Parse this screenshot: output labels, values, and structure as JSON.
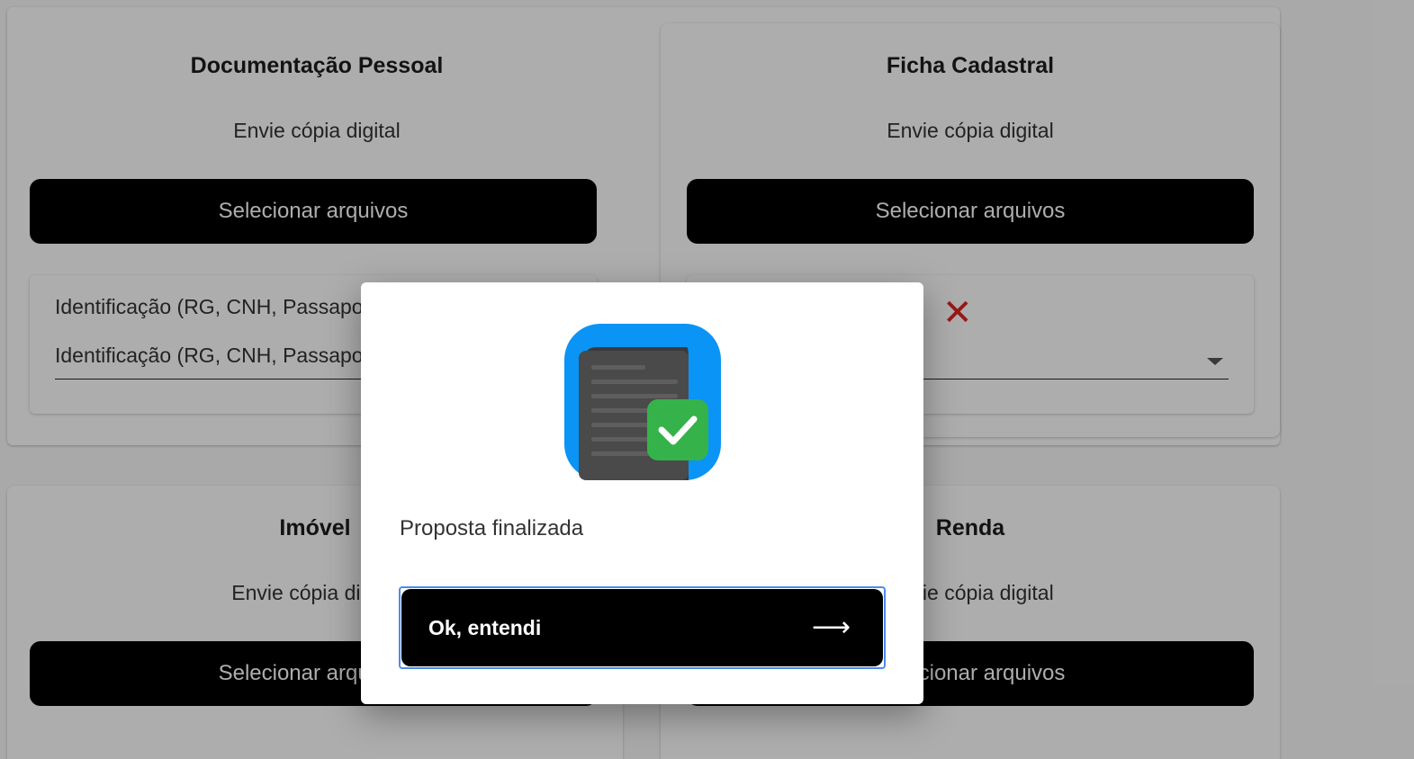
{
  "cards": [
    {
      "title": "Documentação Pessoal",
      "subtitle": "Envie cópia digital",
      "button_label": "Selecionar arquivos",
      "file": {
        "label": "Identificação (RG, CNH, Passaporte)",
        "select_value": "Identificação (RG, CNH, Passaporte)"
      }
    },
    {
      "title": "Ficha Cadastral",
      "subtitle": "Envie cópia digital",
      "button_label": "Selecionar arquivos",
      "file": {
        "remove_icon": "✕"
      }
    },
    {
      "title": "Imóvel",
      "subtitle": "Envie cópia digital",
      "button_label": "Selecionar arquivos"
    },
    {
      "title": "Renda",
      "subtitle": "Envie cópia digital",
      "button_label": "Selecionar arquivos"
    }
  ],
  "modal": {
    "icon": "document-check-icon",
    "message": "Proposta finalizada",
    "button_label": "Ok, entendi",
    "button_arrow": "⟶"
  },
  "colors": {
    "icon_blue": "#0a94f5",
    "icon_green": "#35b34a",
    "remove_red": "#e02424",
    "focus_outline": "#4a8cf0"
  }
}
